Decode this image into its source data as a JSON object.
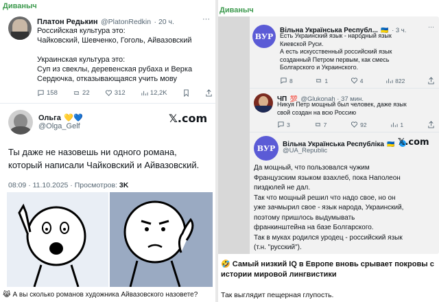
{
  "left": {
    "channel": "Диваныч",
    "tweet1": {
      "name": "Платон Редькин",
      "handle": "@PlatonRedkin",
      "time": "· 20 ч.",
      "lines": [
        "Российская культура это:",
        "Чайковский, Шевченко, Гоголь, Айвазовский",
        "",
        "Украинская культура это:",
        "Суп из свеклы, деревенская рубаха и Верка",
        "Сердючка, отказывающаяся учить мову"
      ],
      "stats": {
        "replies": "158",
        "retweets": "22",
        "likes": "312",
        "views": "12,2K"
      }
    },
    "tweet2": {
      "name": "Ольга",
      "emojis": "💛💙",
      "handle": "@Olga_Gelf",
      "x_logo": "𝕏.com",
      "text_line1": "Ты даже не назовешь ни одного романа,",
      "text_line2": "который написали Чайковский и Айвазовский.",
      "meta": "08:09 · 11.10.2025 · Просмотров: ",
      "views": "3K"
    },
    "caption": "А вы сколько романов художника Айвазовского назовете?"
  },
  "right": {
    "channel": "Диваныч",
    "tweet1": {
      "name": "Вільна Українська Республ...",
      "flag": "🇺🇦",
      "time": "· 3 ч.",
      "avatar_text": "ВУР",
      "lines": [
        "Есть Украинский язык - народный язык",
        "Киевской Руси.",
        "А есть искусственный российский язык",
        "созданный Петром первым, как смесь",
        "Болгарского и Украинского."
      ],
      "stats": {
        "replies": "8",
        "retweets": "1",
        "likes": "4",
        "views": "822"
      }
    },
    "tweet2": {
      "name": "ЧП",
      "badge": "💯",
      "handle": "@Glukonah · 37 мин.",
      "lines": [
        "Никуя Петр мощный был человек, даже язык",
        "свой создан на всю Россию"
      ],
      "stats": {
        "replies": "3",
        "retweets": "7",
        "likes": "92",
        "views": "1"
      }
    },
    "tweet3": {
      "name": "Вільна Українська Республіка",
      "flag": "🇺🇦",
      "handle": "@UA_Republic",
      "avatar_text": "ВУР",
      "x_logo": "𝕏.com",
      "lines": [
        "Да мощный, что пользовался чужим",
        "Французским языком взахлеб, пока Наполеон",
        "пиздюлей не дал.",
        "Так что мощный решил что надо свое, но он",
        "уже зачмырил свое - язык народа, Украинский,",
        "поэтому пришлось выдумывать",
        "франкинштейна на базе Болгарского.",
        "Так в муках родился уродец - российский язык",
        "(т.н. \"русский\")."
      ]
    },
    "caption_line1": "🤣 Самый низкий IQ в Европе вновь срывает покровы с",
    "caption_line2": "истории мировой лингвистики",
    "footer": "Так выглядит пещерная глупость."
  },
  "colors": {
    "channel": "#3d9a4e",
    "vur_avatar": "#5b5bd6",
    "verified": "#1d9bf0",
    "meme_bg_left": "#e9eef5",
    "meme_bg_right": "#9aaac2"
  }
}
